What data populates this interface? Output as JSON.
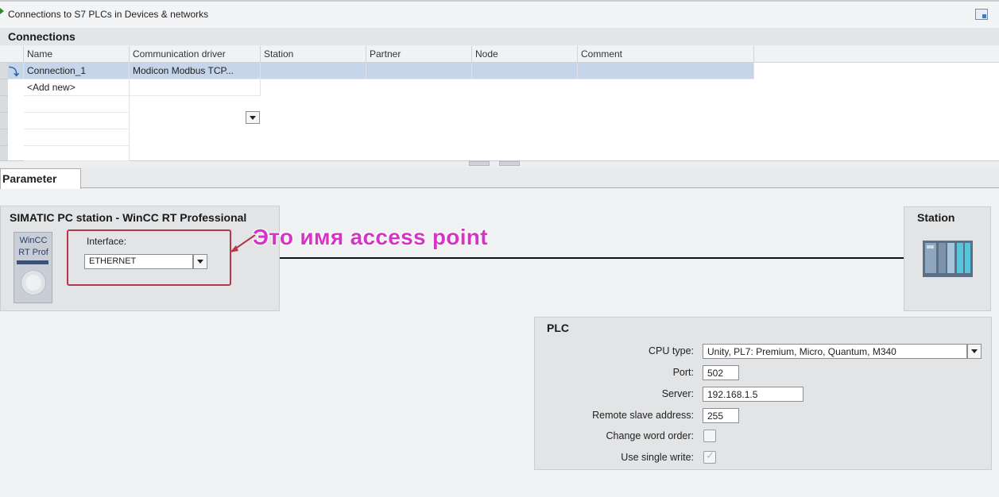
{
  "window": {
    "title": "Connections to S7 PLCs in Devices & networks",
    "section_title": "Connections"
  },
  "table": {
    "columns": [
      "Name",
      "Communication driver",
      "Station",
      "Partner",
      "Node",
      "Comment"
    ],
    "rows": [
      {
        "name": "Connection_1",
        "driver": "Modicon Modbus TCP...",
        "station": "",
        "partner": "",
        "node": "",
        "comment": ""
      }
    ],
    "add_new_label": "<Add new>"
  },
  "tabs": {
    "parameter": "Parameter"
  },
  "simatic": {
    "title": "SIMATIC PC station - WinCC RT Professional",
    "device_label_line1": "WinCC",
    "device_label_line2": "RT Prof",
    "interface_label": "Interface:",
    "interface_value": "ETHERNET"
  },
  "annotation": {
    "text": "Это имя access point",
    "color": "#d534c7"
  },
  "station": {
    "title": "Station"
  },
  "plc": {
    "title": "PLC",
    "cpu_type_label": "CPU type:",
    "cpu_type_value": "Unity, PL7: Premium, Micro, Quantum, M340",
    "port_label": "Port:",
    "port_value": "502",
    "server_label": "Server:",
    "server_value": "192.168.1.5",
    "remote_slave_label": "Remote slave address:",
    "remote_slave_value": "255",
    "change_word_order_label": "Change word order:",
    "change_word_order_checked": false,
    "use_single_write_label": "Use single write:",
    "use_single_write_checked": true
  },
  "colors": {
    "selection": "#c6d5ea",
    "highlight_border": "#b5384a",
    "panel": "#e2e4e6"
  }
}
